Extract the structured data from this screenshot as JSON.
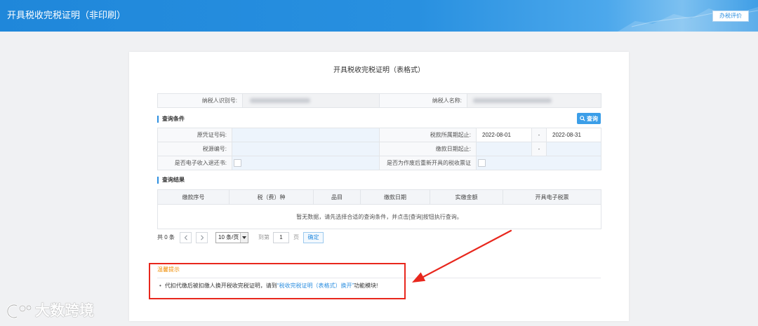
{
  "header": {
    "title": "开具税收完税证明（非印刷）",
    "evaluate_button": "办税评价"
  },
  "card": {
    "title": "开具税收完税证明（表格式）"
  },
  "taxpayer": {
    "id_label": "纳税人识别号:",
    "name_label": "纳税人名称:"
  },
  "query": {
    "section_title": "查询条件",
    "search_button": "查询",
    "search_icon": "search-icon",
    "original_voucher_no": {
      "label": "原凭证号码:",
      "value": ""
    },
    "tax_period": {
      "label": "税款所属期起止:",
      "start": "2022-08-01",
      "separator": "-",
      "end": "2022-08-31"
    },
    "tax_source_no": {
      "label": "税源编号:",
      "value": ""
    },
    "payment_date": {
      "label": "缴款日期起止:",
      "start": "",
      "separator": "-",
      "end": ""
    },
    "electronic_refund": {
      "label": "是否电子收入退还书:",
      "checked": false
    },
    "reissued_after_void": {
      "label": "是否为作废后重新开具的税收票证",
      "checked": false
    }
  },
  "results": {
    "section_title": "查询结果",
    "columns": [
      "缴款序号",
      "税（费）种",
      "品目",
      "缴款日期",
      "实缴金额",
      "开具电子税票"
    ],
    "rows": [],
    "empty_text": "暂无数据，请先选择合适的查询条件，并点击[查询]按钮执行查询。"
  },
  "pagination": {
    "total_prefix": "共",
    "total": "0",
    "total_suffix": "条",
    "prev_icon": "chevron-left-icon",
    "next_icon": "chevron-right-icon",
    "page_size": "10 条/页",
    "goto_prefix": "到第",
    "page": "1",
    "goto_suffix": "页",
    "confirm_button": "确定"
  },
  "tip": {
    "title": "温馨提示",
    "text_before": "代扣代缴后被扣缴人换开税收完税证明，请到",
    "link": "“税收完税证明（表格式）换开”",
    "text_after": "功能模块!"
  },
  "watermark": {
    "text": "大数跨境",
    "icon": "brand-logo-icon"
  },
  "colors": {
    "primary": "#2d8fe0",
    "header_bg": "#1f87da",
    "highlight": "#e8271d",
    "tip_title": "#f08c00",
    "input_bg": "#edf4fc"
  }
}
